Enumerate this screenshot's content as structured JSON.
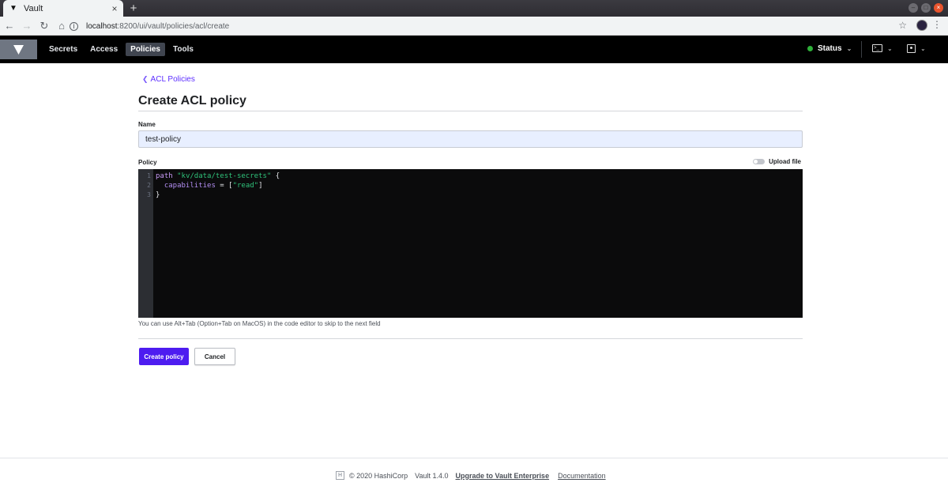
{
  "browser": {
    "tab_title": "Vault",
    "tab_close": "×",
    "new_tab": "+",
    "url_host": "localhost",
    "url_path": ":8200/ui/vault/policies/acl/create"
  },
  "nav": {
    "items": [
      {
        "label": "Secrets",
        "active": false
      },
      {
        "label": "Access",
        "active": false
      },
      {
        "label": "Policies",
        "active": true
      },
      {
        "label": "Tools",
        "active": false
      }
    ],
    "status_label": "Status",
    "status_color": "#2eb039"
  },
  "page": {
    "breadcrumb": "ACL Policies",
    "title": "Create ACL policy",
    "name_label": "Name",
    "name_value": "test-policy",
    "policy_label": "Policy",
    "upload_label": "Upload file",
    "upload_enabled": false,
    "code_lines": [
      "1",
      "2",
      "3"
    ],
    "help_text": "You can use Alt+Tab (Option+Tab on MacOS) in the code editor to skip to the next field",
    "create_label": "Create policy",
    "cancel_label": "Cancel",
    "accent_color": "#4d1cf0"
  },
  "code": {
    "l1_kw": "path",
    "l1_str": "\"kv/data/test-secrets\"",
    "l1_brace": " {",
    "l2_attr": "capabilities",
    "l2_eq": " = [",
    "l2_str": "\"read\"",
    "l2_end": "]",
    "l3": "}"
  },
  "footer": {
    "copyright": "© 2020 HashiCorp",
    "version": "Vault 1.4.0",
    "upgrade": "Upgrade to Vault Enterprise",
    "docs": "Documentation"
  }
}
